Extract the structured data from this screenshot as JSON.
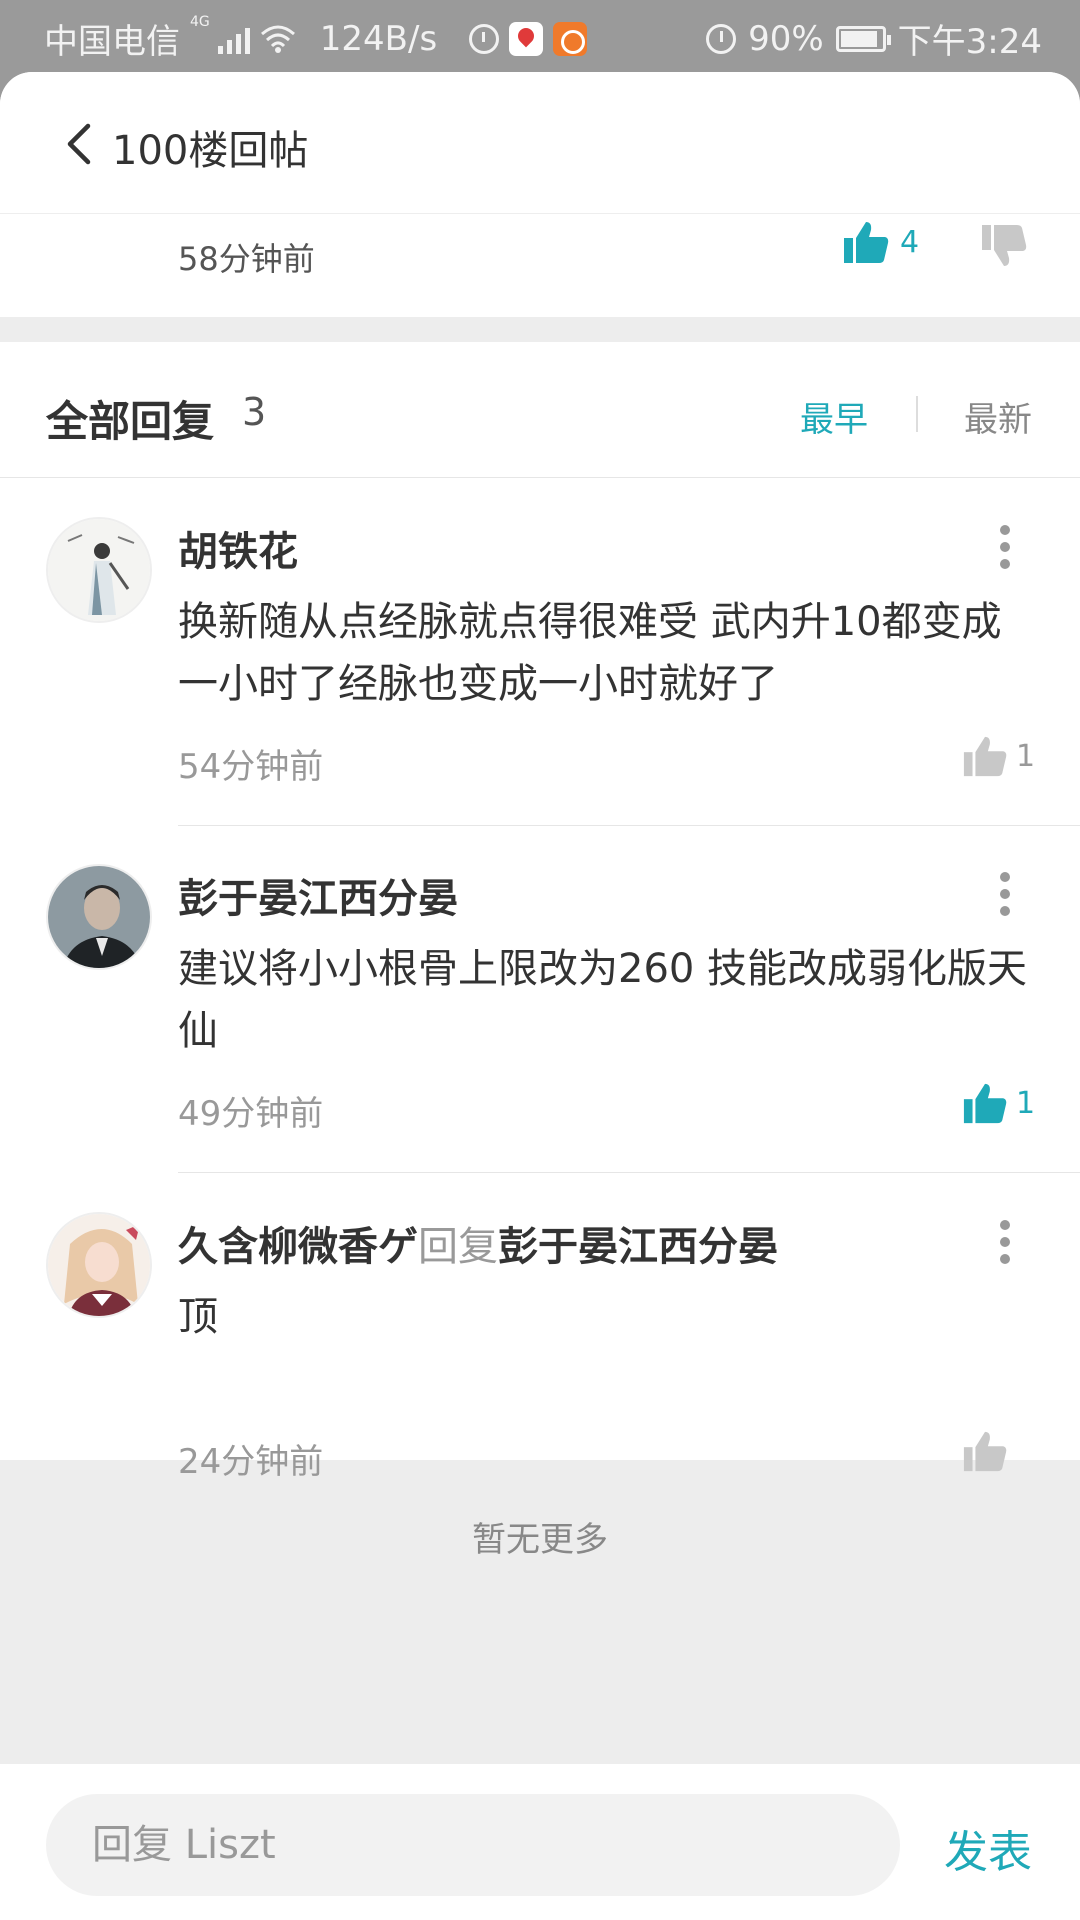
{
  "status_bar": {
    "carrier": "中国电信",
    "net_tag": "4G",
    "speed": "124B/s",
    "battery": "90%",
    "battery_level": 0.9,
    "time": "下午3:24"
  },
  "header": {
    "title": "100楼回帖"
  },
  "prev_post": {
    "time": "58分钟前",
    "likes": "4"
  },
  "replies_section": {
    "title": "全部回复",
    "count": "3",
    "sort_earliest": "最早",
    "sort_latest": "最新",
    "active_sort": "最早"
  },
  "replies": [
    {
      "author": "胡铁花",
      "content": "换新随从点经脉就点得很难受  武内升10都变成一小时了经脉也变成一小时就好了",
      "time": "54分钟前",
      "likes": "1",
      "liked": false
    },
    {
      "author": "彭于晏江西分晏",
      "content": "建议将小小根骨上限改为260 技能改成弱化版天仙",
      "time": "49分钟前",
      "likes": "1",
      "liked": true
    },
    {
      "author": "久含柳微香ゲ",
      "reply_word": "回复",
      "reply_to": "彭于晏江西分晏",
      "content": "顶",
      "time": "24分钟前",
      "likes": "",
      "liked": false
    }
  ],
  "footer_note": "暂无更多",
  "bottom_bar": {
    "input_placeholder": "回复 Liszt",
    "publish_label": "发表"
  },
  "colors": {
    "accent": "#1fa9b8",
    "muted": "#999999",
    "background": "#ededed"
  },
  "icons": [
    "back-icon",
    "thumbs-up-icon",
    "thumbs-down-icon",
    "more-icon",
    "wifi-icon",
    "alarm-icon",
    "battery-icon"
  ]
}
